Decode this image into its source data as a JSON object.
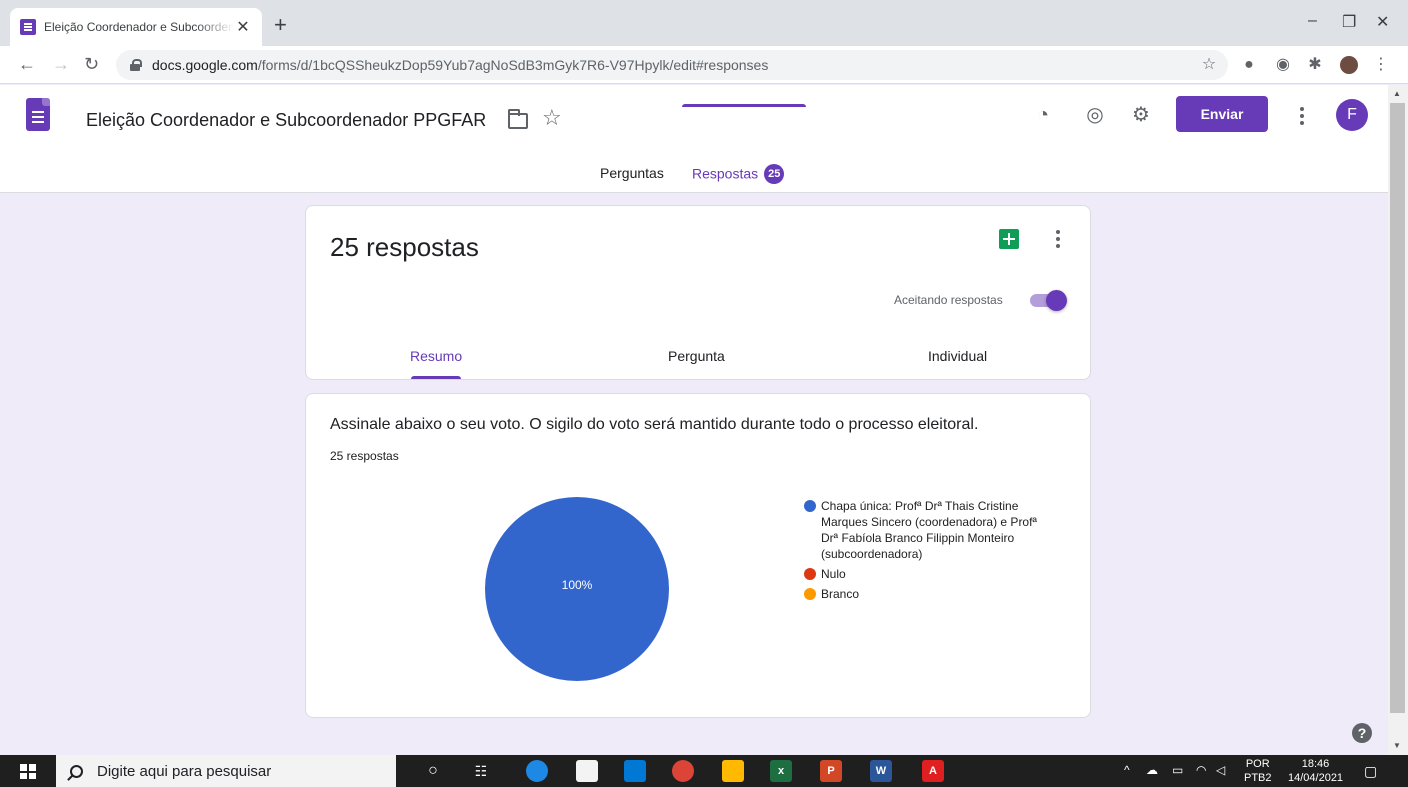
{
  "browser": {
    "tab_title": "Eleição Coordenador e Subcoordenador PPGFAR",
    "tab_close": "✕",
    "new_tab": "+",
    "url_host": "docs.google.com",
    "url_path": "/forms/d/1bcQSSheukzDop59Yub7agNoSdB3mGyk7R6-V97Hpylk/edit#responses",
    "window_controls": [
      "–",
      "❐",
      "✕"
    ]
  },
  "header": {
    "form_title": "Eleição Coordenador e Subcoordenador PPGFAR",
    "send_label": "Enviar",
    "avatar_initial": "F",
    "tabs": {
      "questions": "Perguntas",
      "responses": "Respostas",
      "responses_badge": "25"
    }
  },
  "summary_card": {
    "response_count": "25 respostas",
    "accepting_label": "Aceitando respostas",
    "accepting": true,
    "tabs": [
      "Resumo",
      "Pergunta",
      "Individual"
    ]
  },
  "question_card": {
    "title": "Assinale abaixo o seu voto. O sigilo do voto será mantido durante todo o processo eleitoral.",
    "count": "25 respostas"
  },
  "chart_data": {
    "type": "pie",
    "categories": [
      "Chapa única: Profª Drª Thais Cristine Marques Sincero (coordenadora) e Profª Drª Fabíola Branco Filippin Monteiro (subcoordenadora)",
      "Nulo",
      "Branco"
    ],
    "values": [
      100,
      0,
      0
    ],
    "colors": [
      "#3366cc",
      "#dc3912",
      "#ff9900"
    ],
    "slice_label": "100%",
    "legend": "right"
  },
  "taskbar": {
    "search_placeholder": "Digite aqui para pesquisar",
    "lang_top": "POR",
    "lang_bottom": "PTB2",
    "time": "18:46",
    "date": "14/04/2021"
  },
  "colors": {
    "accent": "#673ab7",
    "page_bg": "#f0ebf8",
    "sheets_green": "#0f9d58"
  }
}
